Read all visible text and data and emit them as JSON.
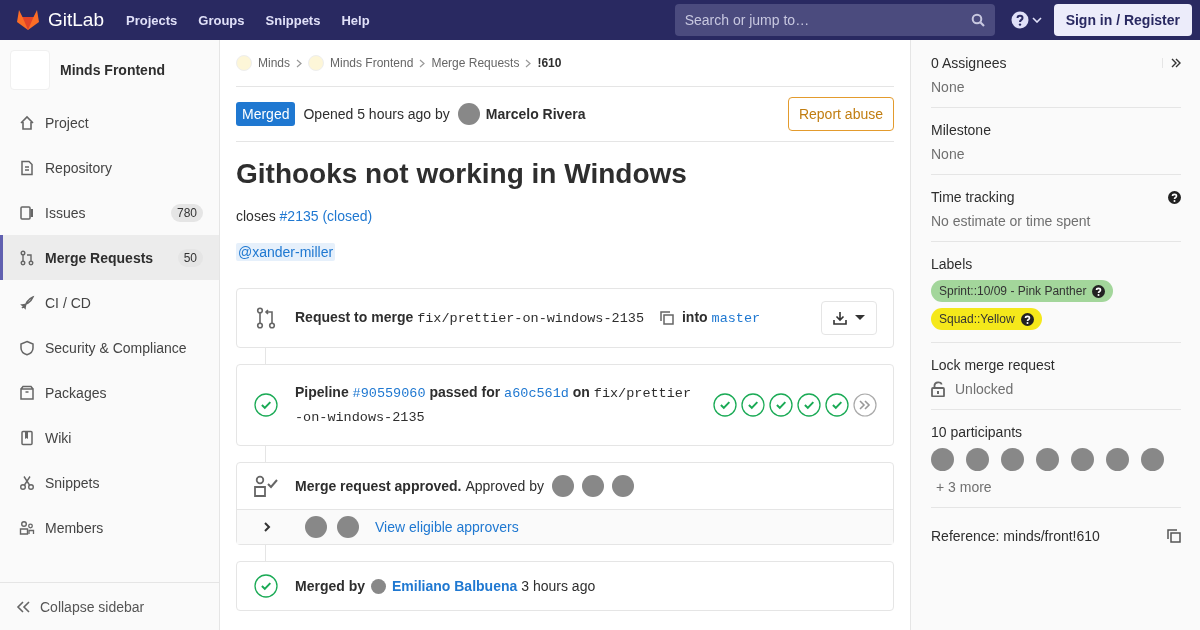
{
  "header": {
    "logo": "GitLab",
    "nav": [
      "Projects",
      "Groups",
      "Snippets",
      "Help"
    ],
    "search": {
      "placeholder": "Search or jump to…"
    },
    "sign_in": "Sign in / Register"
  },
  "sidebar": {
    "project": "Minds Frontend",
    "items": [
      {
        "label": "Project",
        "selected": false
      },
      {
        "label": "Repository",
        "selected": false
      },
      {
        "label": "Issues",
        "count": "780",
        "selected": false
      },
      {
        "label": "Merge Requests",
        "count": "50",
        "selected": true
      },
      {
        "label": "CI / CD",
        "selected": false
      },
      {
        "label": "Security & Compliance",
        "selected": false
      },
      {
        "label": "Packages",
        "selected": false
      },
      {
        "label": "Wiki",
        "selected": false
      },
      {
        "label": "Snippets",
        "selected": false
      },
      {
        "label": "Members",
        "selected": false
      }
    ],
    "collapse": "Collapse sidebar"
  },
  "breadcrumbs": [
    {
      "label": "Minds",
      "kind": "group"
    },
    {
      "label": "Minds Frontend",
      "kind": "group"
    },
    {
      "label": "Merge Requests",
      "kind": "link"
    },
    {
      "label": "!610",
      "kind": "current"
    }
  ],
  "merge_request": {
    "status": "Merged",
    "opened": "Opened 5 hours ago by",
    "author": "Marcelo Rivera",
    "report": "Report abuse",
    "title": "Githooks not working in Windows",
    "description": {
      "text": "closes",
      "link": "#2135 (closed)"
    },
    "mention": "@xander-miller"
  },
  "widgets": {
    "request": {
      "label": "Request to merge",
      "source": "fix/prettier-on-windows-2135",
      "into": "into",
      "target": "master"
    },
    "pipeline": {
      "label": "Pipeline",
      "id": "#90559060",
      "passed": "passed for",
      "commit": "a60c561d",
      "on": "on",
      "branch": "fix/prettier-on-windows-2135",
      "stages": [
        {
          "kind": "success"
        },
        {
          "kind": "success"
        },
        {
          "kind": "success"
        },
        {
          "kind": "success"
        },
        {
          "kind": "success"
        },
        {
          "kind": "downstream"
        }
      ]
    },
    "approval": {
      "title": "Merge request approved.",
      "by": "Approved by",
      "approvers": [
        {
          "kind": "photo"
        },
        {
          "kind": "photo"
        },
        {
          "kind": "photo"
        }
      ],
      "eligible": [
        {
          "kind": "photo"
        },
        {
          "kind": "photo"
        }
      ],
      "link": "View eligible approvers",
      "expanded": false
    },
    "merged": {
      "label": "Merged by",
      "user": "Emiliano Balbuena",
      "time": "3 hours ago"
    }
  },
  "right_sidebar": {
    "assignees": {
      "title": "0 Assignees",
      "value": "None"
    },
    "milestone": {
      "title": "Milestone",
      "value": "None"
    },
    "time_tracking": {
      "title": "Time tracking",
      "value": "No estimate or time spent"
    },
    "labels": {
      "title": "Labels",
      "items": [
        {
          "text": "Sprint::10/09 - Pink Panther",
          "color": "#a3d69b"
        },
        {
          "text": "Squad::Yellow",
          "color": "#f5e81b"
        }
      ]
    },
    "lock": {
      "title": "Lock merge request",
      "value": "Unlocked",
      "locked": false
    },
    "participants": {
      "title": "10 participants",
      "avatars": [
        {
          "kind": "photo"
        },
        {
          "kind": "photo"
        },
        {
          "kind": "photo"
        },
        {
          "kind": "photo"
        },
        {
          "kind": "photo"
        },
        {
          "kind": "photo"
        },
        {
          "kind": "photo"
        }
      ],
      "more": "+ 3 more"
    },
    "reference": "Reference: minds/front!610"
  }
}
